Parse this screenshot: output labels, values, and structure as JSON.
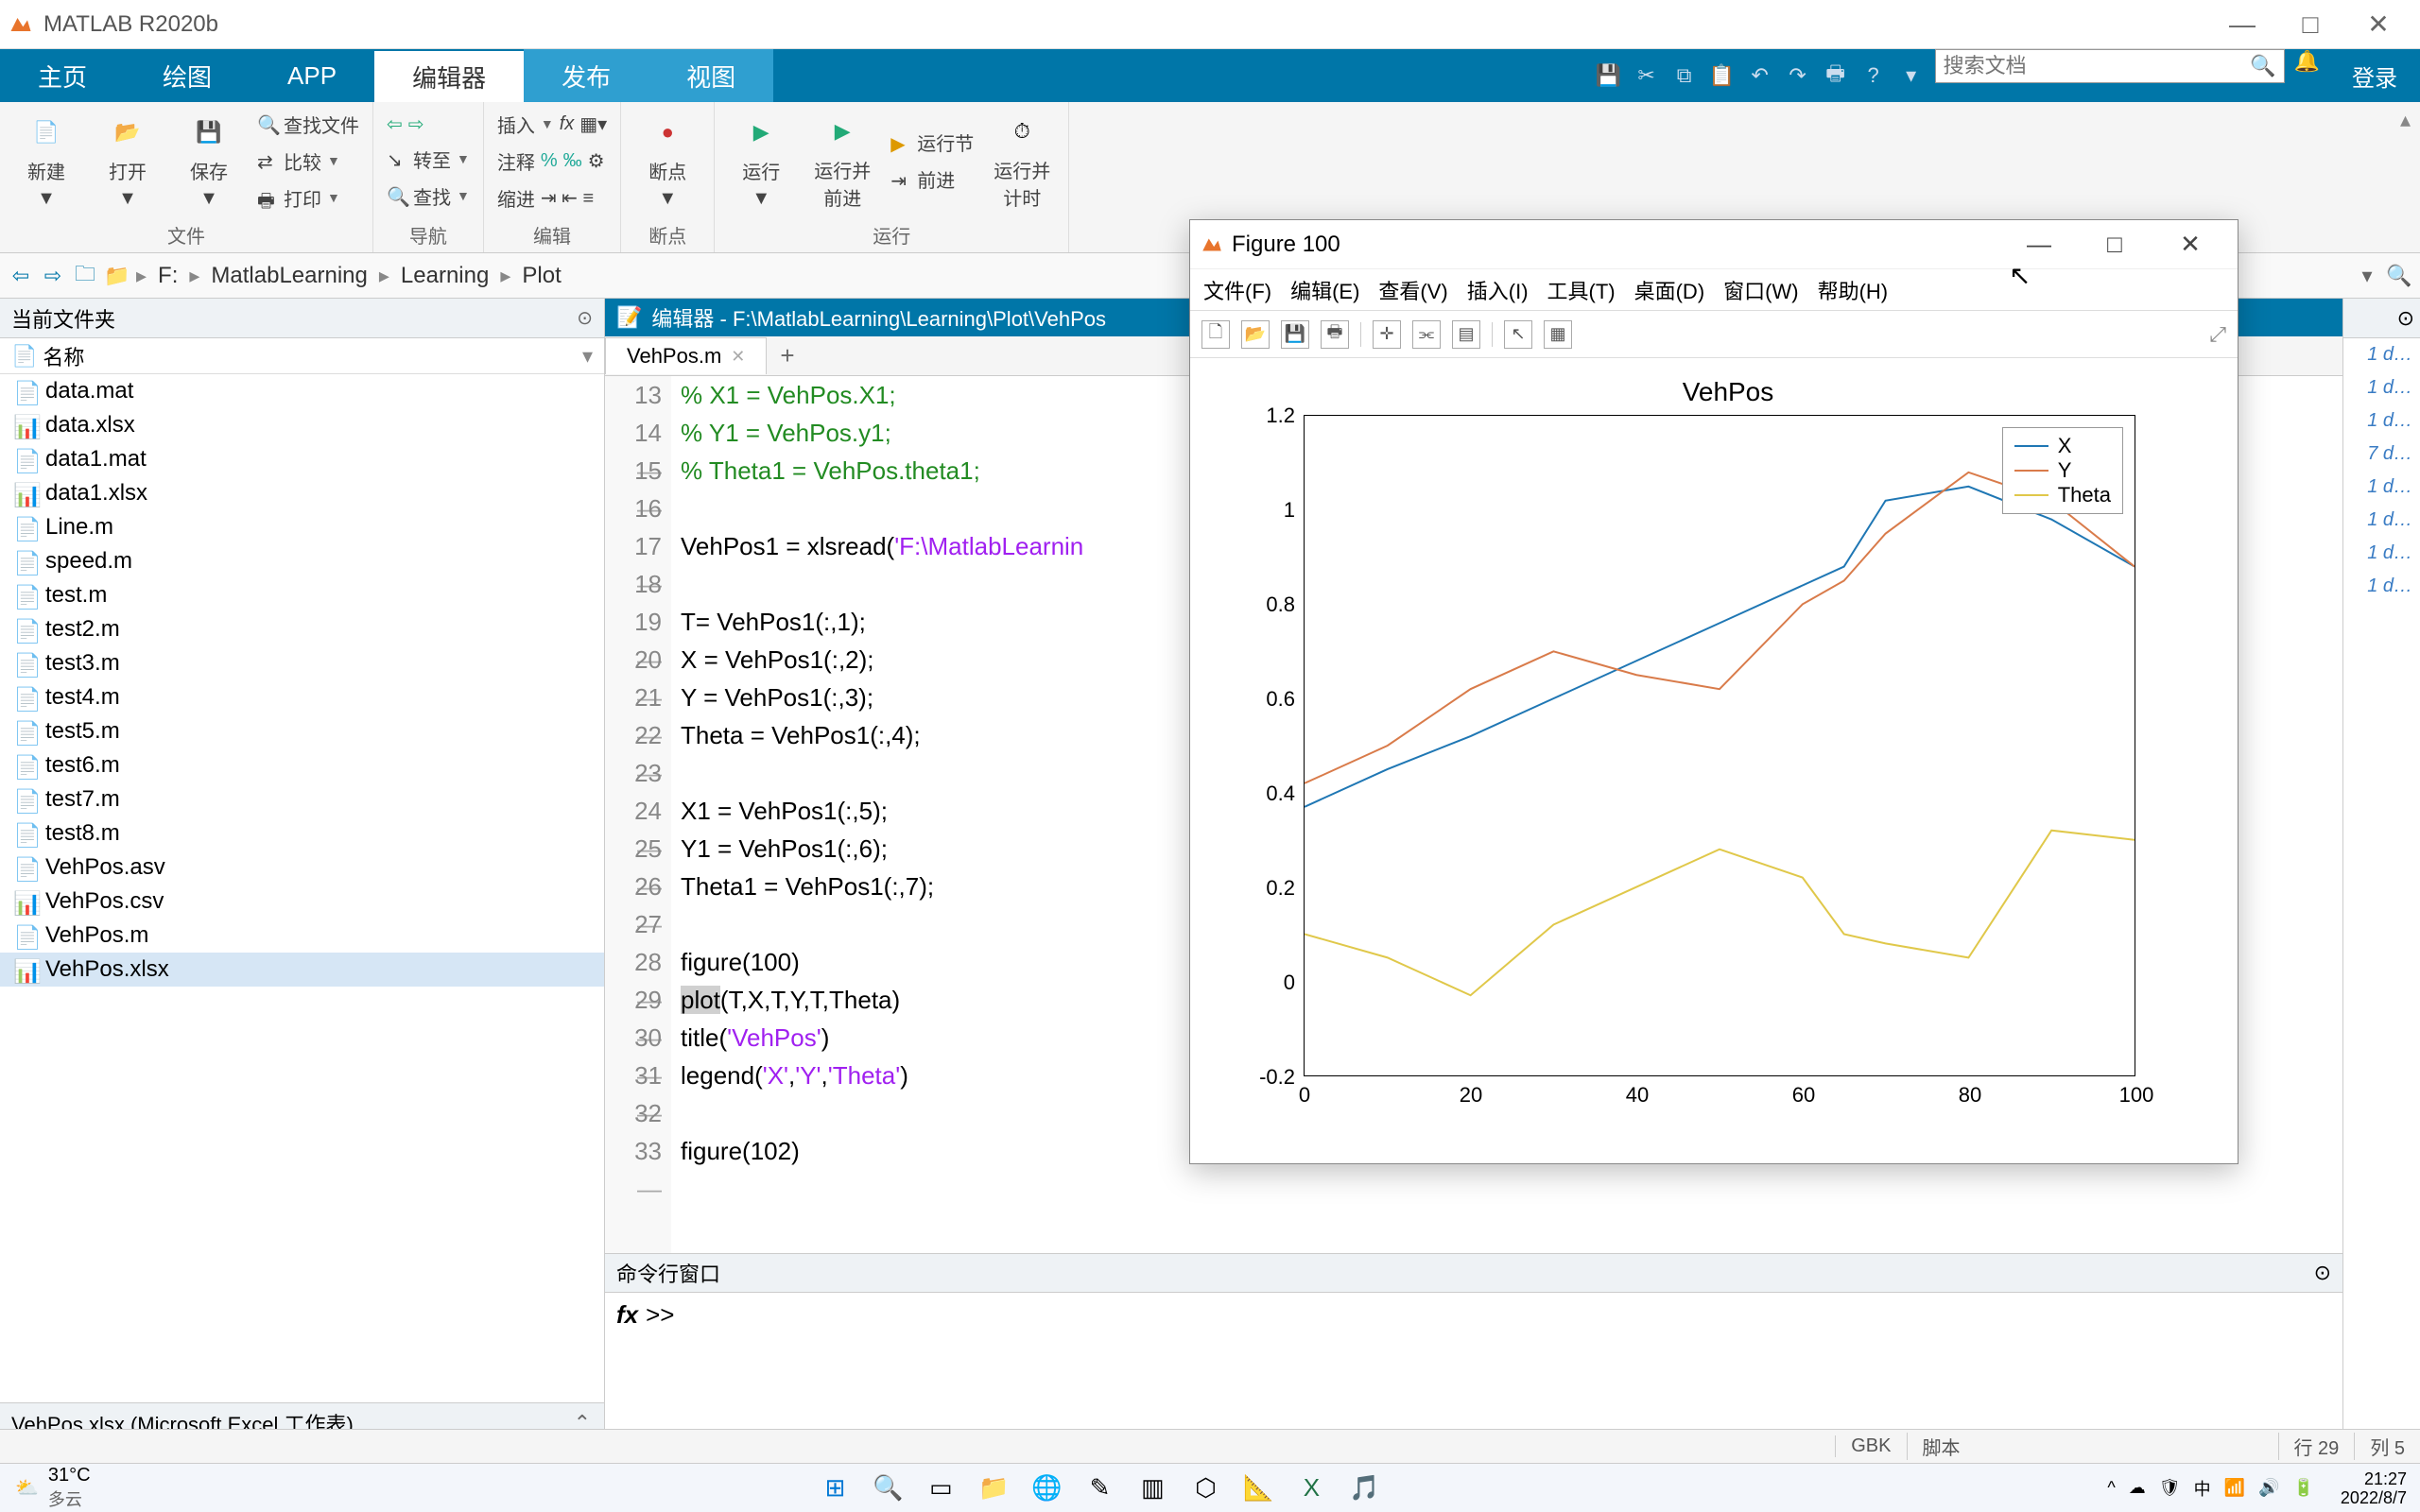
{
  "app": {
    "title": "MATLAB R2020b"
  },
  "tabs": {
    "home": "主页",
    "plots": "绘图",
    "apps": "APP",
    "editor": "编辑器",
    "publish": "发布",
    "view": "视图"
  },
  "qat_search_placeholder": "搜索文档",
  "login_label": "登录",
  "ribbon": {
    "file_group": "文件",
    "nav_group": "导航",
    "edit_group": "编辑",
    "bp_group": "断点",
    "run_group": "运行",
    "new": "新建",
    "open": "打开",
    "save": "保存",
    "findfiles": "查找文件",
    "compare": "比较",
    "print": "打印",
    "goto": "转至",
    "find": "查找",
    "insert": "插入",
    "comment": "注释",
    "indent": "缩进",
    "breakpoints": "断点",
    "run": "运行",
    "run_advance": "运行并\n前进",
    "run_section": "运行节",
    "advance": "前进",
    "run_time": "运行并\n计时"
  },
  "breadcrumb": [
    "F:",
    "MatlabLearning",
    "Learning",
    "Plot"
  ],
  "left": {
    "title": "当前文件夹",
    "col": "名称",
    "files": [
      {
        "n": "data.mat",
        "t": "mat"
      },
      {
        "n": "data.xlsx",
        "t": "xl"
      },
      {
        "n": "data1.mat",
        "t": "mat"
      },
      {
        "n": "data1.xlsx",
        "t": "xl"
      },
      {
        "n": "Line.m",
        "t": "m"
      },
      {
        "n": "speed.m",
        "t": "m"
      },
      {
        "n": "test.m",
        "t": "m"
      },
      {
        "n": "test2.m",
        "t": "m"
      },
      {
        "n": "test3.m",
        "t": "m"
      },
      {
        "n": "test4.m",
        "t": "m"
      },
      {
        "n": "test5.m",
        "t": "m"
      },
      {
        "n": "test6.m",
        "t": "m"
      },
      {
        "n": "test7.m",
        "t": "m"
      },
      {
        "n": "test8.m",
        "t": "m"
      },
      {
        "n": "VehPos.asv",
        "t": "asv"
      },
      {
        "n": "VehPos.csv",
        "t": "xl"
      },
      {
        "n": "VehPos.m",
        "t": "m"
      },
      {
        "n": "VehPos.xlsx",
        "t": "xl"
      }
    ],
    "selected": "VehPos.xlsx",
    "detail": "VehPos.xlsx  (Microsoft Excel 工作表)"
  },
  "editor": {
    "title": "编辑器 - F:\\MatlabLearning\\Learning\\Plot\\VehPos",
    "tab": "VehPos.m",
    "lines": [
      13,
      14,
      15,
      16,
      17,
      18,
      19,
      20,
      21,
      22,
      23,
      24,
      25,
      26,
      27,
      28,
      29,
      30,
      31,
      32,
      33
    ],
    "dash": [
      14,
      15,
      17,
      19,
      20,
      21,
      22,
      24,
      25,
      26,
      28,
      29,
      30,
      31,
      33
    ],
    "code": [
      {
        "t": "cm",
        "s": "% X1 = VehPos.X1;"
      },
      {
        "t": "cm",
        "s": "% Y1 = VehPos.y1;"
      },
      {
        "t": "cm",
        "s": "% Theta1 = VehPos.theta1;"
      },
      {
        "t": "",
        "s": ""
      },
      {
        "t": "mix",
        "parts": [
          {
            "c": "",
            "s": "VehPos1 = xlsread("
          },
          {
            "c": "str",
            "s": "'F:\\MatlabLearnin"
          }
        ]
      },
      {
        "t": "",
        "s": ""
      },
      {
        "t": "",
        "s": "T= VehPos1(:,1);"
      },
      {
        "t": "",
        "s": "X = VehPos1(:,2);"
      },
      {
        "t": "",
        "s": "Y = VehPos1(:,3);"
      },
      {
        "t": "",
        "s": "Theta = VehPos1(:,4);"
      },
      {
        "t": "",
        "s": ""
      },
      {
        "t": "",
        "s": "X1 = VehPos1(:,5);"
      },
      {
        "t": "",
        "s": "Y1 = VehPos1(:,6);"
      },
      {
        "t": "",
        "s": "Theta1 = VehPos1(:,7);"
      },
      {
        "t": "",
        "s": ""
      },
      {
        "t": "",
        "s": "figure(100)"
      },
      {
        "t": "mix",
        "parts": [
          {
            "c": "hl",
            "s": "plot"
          },
          {
            "c": "",
            "s": "(T,X,T,Y,T,Theta)"
          }
        ]
      },
      {
        "t": "mix",
        "parts": [
          {
            "c": "",
            "s": "title("
          },
          {
            "c": "str",
            "s": "'VehPos'"
          },
          {
            "c": "",
            "s": ")"
          }
        ]
      },
      {
        "t": "mix",
        "parts": [
          {
            "c": "",
            "s": "legend("
          },
          {
            "c": "str",
            "s": "'X'"
          },
          {
            "c": "",
            "s": ","
          },
          {
            "c": "str",
            "s": "'Y'"
          },
          {
            "c": "",
            "s": ","
          },
          {
            "c": "str",
            "s": "'Theta'"
          },
          {
            "c": "",
            "s": ")"
          }
        ]
      },
      {
        "t": "",
        "s": ""
      },
      {
        "t": "",
        "s": "figure(102)"
      }
    ]
  },
  "cmd": {
    "title": "命令行窗口",
    "prompt": ">>"
  },
  "workspace_vals": [
    "1 d…",
    "1 d…",
    "1 d…",
    "7 d…",
    "1 d…",
    "1 d…",
    "1 d…",
    "1 d…"
  ],
  "status": {
    "enc": "GBK",
    "mode": "脚本",
    "ln": "行  29",
    "col": "列  5"
  },
  "figure": {
    "title": "Figure 100",
    "menus": [
      "文件(F)",
      "编辑(E)",
      "查看(V)",
      "插入(I)",
      "工具(T)",
      "桌面(D)",
      "窗口(W)",
      "帮助(H)"
    ],
    "chart_title": "VehPos",
    "legend": [
      "X",
      "Y",
      "Theta"
    ]
  },
  "chart_data": {
    "type": "line",
    "title": "VehPos",
    "xlabel": "",
    "ylabel": "",
    "xlim": [
      0,
      100
    ],
    "ylim": [
      -0.2,
      1.2
    ],
    "xticks": [
      0,
      20,
      40,
      60,
      80,
      100
    ],
    "yticks": [
      -0.2,
      0,
      0.2,
      0.4,
      0.6,
      0.8,
      1,
      1.2
    ],
    "x": [
      0,
      10,
      20,
      30,
      40,
      50,
      60,
      65,
      70,
      80,
      90,
      100
    ],
    "series": [
      {
        "name": "X",
        "color": "#1f77b4",
        "values": [
          0.37,
          0.45,
          0.52,
          0.6,
          0.68,
          0.76,
          0.84,
          0.88,
          1.02,
          1.05,
          0.98,
          0.88
        ]
      },
      {
        "name": "Y",
        "color": "#d97b4a",
        "values": [
          0.42,
          0.5,
          0.62,
          0.7,
          0.65,
          0.62,
          0.8,
          0.85,
          0.95,
          1.08,
          1.02,
          0.88
        ]
      },
      {
        "name": "Theta",
        "color": "#e0c84a",
        "values": [
          0.1,
          0.05,
          -0.03,
          0.12,
          0.2,
          0.28,
          0.22,
          0.1,
          0.08,
          0.05,
          0.32,
          0.3
        ]
      }
    ]
  },
  "taskbar": {
    "temp": "31°C",
    "cond": "多云",
    "time": "21:27",
    "date": "2022/8/7"
  }
}
